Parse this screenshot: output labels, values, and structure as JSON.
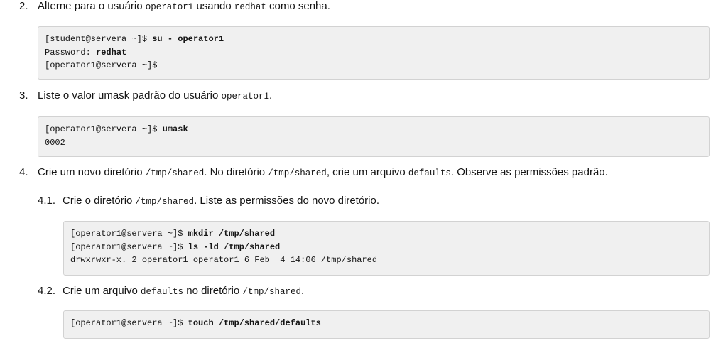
{
  "steps": [
    {
      "num": "2.",
      "parts": [
        "Alterne para o usuário ",
        "operator1",
        " usando ",
        "redhat",
        " como senha."
      ],
      "code": [
        {
          "prompt": "[student@servera ~]$ ",
          "cmd": "su - operator1"
        },
        {
          "prompt": "Password: ",
          "cmd": "redhat"
        },
        {
          "prompt": "[operator1@servera ~]$",
          "cmd": ""
        }
      ]
    },
    {
      "num": "3.",
      "parts": [
        "Liste o valor umask padrão do usuário ",
        "operator1",
        "."
      ],
      "code": [
        {
          "prompt": "[operator1@servera ~]$ ",
          "cmd": "umask"
        },
        {
          "prompt": "0002",
          "cmd": ""
        }
      ]
    },
    {
      "num": "4.",
      "parts": [
        "Crie um novo diretório ",
        "/tmp/shared",
        ". No diretório ",
        "/tmp/shared",
        ", crie um arquivo ",
        "defaults",
        ". Observe as permissões padrão."
      ]
    },
    {
      "num": "4.1.",
      "parts": [
        "Crie o diretório ",
        "/tmp/shared",
        ". Liste as permissões do novo diretório."
      ],
      "code": [
        {
          "prompt": "[operator1@servera ~]$ ",
          "cmd": "mkdir /tmp/shared"
        },
        {
          "prompt": "[operator1@servera ~]$ ",
          "cmd": "ls -ld /tmp/shared"
        },
        {
          "prompt": "drwxrwxr-x. 2 operator1 operator1 6 Feb  4 14:06 /tmp/shared",
          "cmd": ""
        }
      ]
    },
    {
      "num": "4.2.",
      "parts": [
        "Crie um arquivo ",
        "defaults",
        " no diretório ",
        "/tmp/shared",
        "."
      ],
      "code": [
        {
          "prompt": "[operator1@servera ~]$ ",
          "cmd": "touch /tmp/shared/defaults"
        }
      ]
    }
  ]
}
